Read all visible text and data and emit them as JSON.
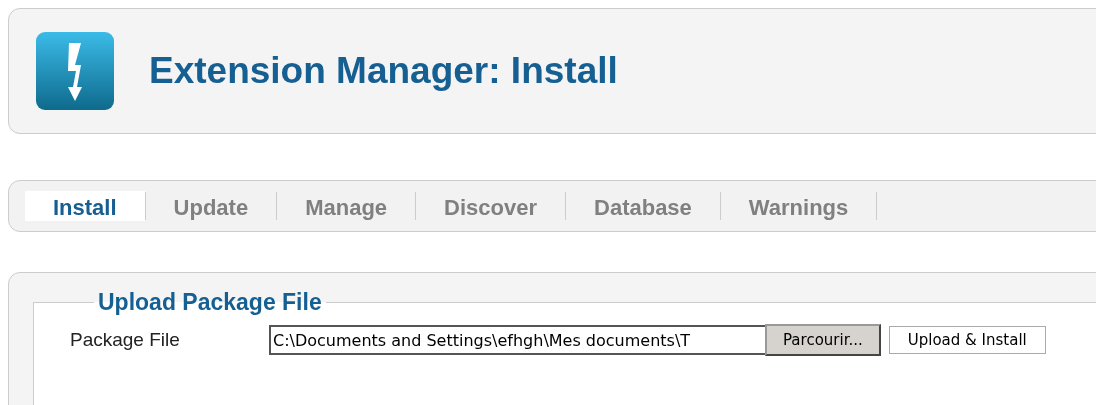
{
  "header": {
    "title": "Extension Manager: Install"
  },
  "tabs": [
    {
      "label": "Install",
      "selected": true
    },
    {
      "label": "Update",
      "selected": false
    },
    {
      "label": "Manage",
      "selected": false
    },
    {
      "label": "Discover",
      "selected": false
    },
    {
      "label": "Database",
      "selected": false
    },
    {
      "label": "Warnings",
      "selected": false
    }
  ],
  "upload": {
    "legend": "Upload Package File",
    "label": "Package File",
    "file_value": "C:\\Documents and Settings\\efhgh\\Mes documents\\T",
    "browse_button": "Parcourir...",
    "submit_button": "Upload & Install"
  }
}
